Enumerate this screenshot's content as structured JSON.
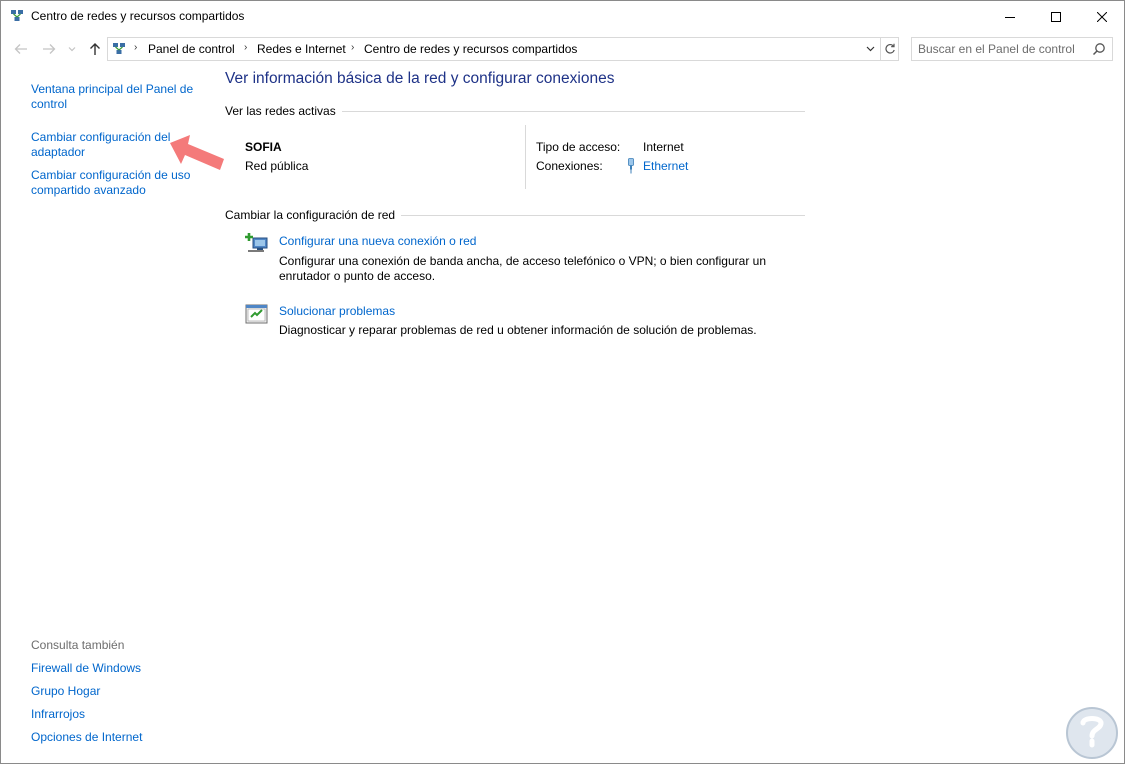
{
  "window": {
    "title": "Centro de redes y recursos compartidos"
  },
  "address": {
    "crumbs": [
      "Panel de control",
      "Redes e Internet",
      "Centro de redes y recursos compartidos"
    ]
  },
  "search": {
    "placeholder": "Buscar en el Panel de control"
  },
  "sidebar": {
    "links": [
      "Ventana principal del Panel de control",
      "Cambiar configuración del adaptador",
      "Cambiar configuración de uso compartido avanzado"
    ],
    "see_also_label": "Consulta también",
    "see_also_links": [
      "Firewall de Windows",
      "Grupo Hogar",
      "Infrarrojos",
      "Opciones de Internet"
    ]
  },
  "main": {
    "title": "Ver información básica de la red y configurar conexiones",
    "active_networks_label": "Ver las redes activas",
    "network": {
      "name": "SOFIA",
      "category": "Red pública",
      "access_type_label": "Tipo de acceso:",
      "access_type_value": "Internet",
      "connections_label": "Conexiones:",
      "connections_value": "Ethernet"
    },
    "change_settings_label": "Cambiar la configuración de red",
    "tasks": [
      {
        "title": "Configurar una nueva conexión o red",
        "description": "Configurar una conexión de banda ancha, de acceso telefónico o VPN; o bien configurar un enrutador o punto de acceso."
      },
      {
        "title": "Solucionar problemas",
        "description": "Diagnosticar y reparar problemas de red u obtener información de solución de problemas."
      }
    ]
  },
  "colors": {
    "link": "#0066cc",
    "heading": "#1e3287",
    "annotation_arrow": "#f47a7a"
  }
}
